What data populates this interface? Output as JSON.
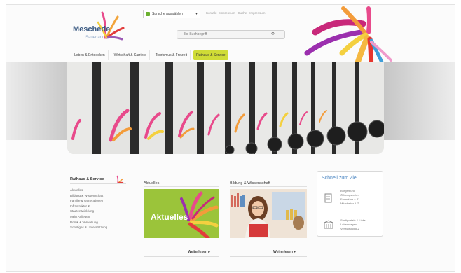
{
  "header": {
    "logo_text": "Meschede",
    "logo_sub": "Sauerland",
    "language_button": "Sprache auswählen",
    "top_links": [
      "Kontakt",
      "Impressum",
      "Suche",
      "Impressum"
    ],
    "search_placeholder": "Ihr Suchbegriff"
  },
  "nav": {
    "items": [
      {
        "label": "Leben & Entdecken"
      },
      {
        "label": "Wirtschaft & Karriere"
      },
      {
        "label": "Tourismus & Freizeit"
      },
      {
        "label": "Rathaus & Service"
      }
    ],
    "active_index": 3
  },
  "sidebar": {
    "title": "Rathaus & Service",
    "items": [
      "Aktuelles",
      "Bildung & Wissenschaft",
      "Familie & Generationen",
      "Infrastruktur &",
      "Stadtentwicklung",
      "Mein Anliegen",
      "Politik & Verwaltung",
      "Sonstiges & Unterstützung"
    ]
  },
  "columns": [
    {
      "title": "Aktuelles",
      "tile_text": "Aktuelles",
      "more": "Weiterlesen"
    },
    {
      "title": "Bildung & Wissenschaft",
      "more": "Weiterlesen"
    }
  ],
  "quick": {
    "title": "Schnell zum Ziel",
    "group1": [
      "Bürgerbüro",
      "Öffnungszeiten",
      "Formulare A-Z",
      "Mitarbeiter A-Z"
    ],
    "group2": [
      "Stadtportale & Links",
      "Lebenslagen",
      "Verwaltung A-Z"
    ]
  },
  "colors": {
    "accent_green": "#cfdc36",
    "tile_green": "#9bc43a",
    "link_blue": "#4b86c2",
    "logo_blue": "#3b5a82"
  }
}
